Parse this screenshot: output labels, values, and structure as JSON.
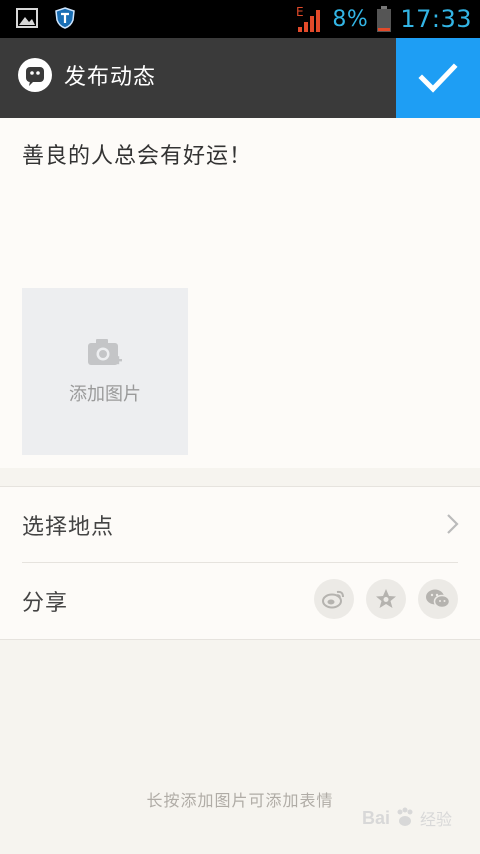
{
  "status_bar": {
    "network": "E",
    "battery": "8%",
    "time": "17:33"
  },
  "header": {
    "title": "发布动态"
  },
  "compose": {
    "text": "善良的人总会有好运！",
    "add_photo_label": "添加图片"
  },
  "options": {
    "location_label": "选择地点",
    "share_label": "分享"
  },
  "footer": {
    "hint": "长按添加图片可添加表情"
  },
  "watermark": {
    "brand": "Bai",
    "suffix": "经验"
  },
  "colors": {
    "accent": "#1e9ef4",
    "titlebar": "#3a3a3a",
    "status": "#33b5e5"
  }
}
